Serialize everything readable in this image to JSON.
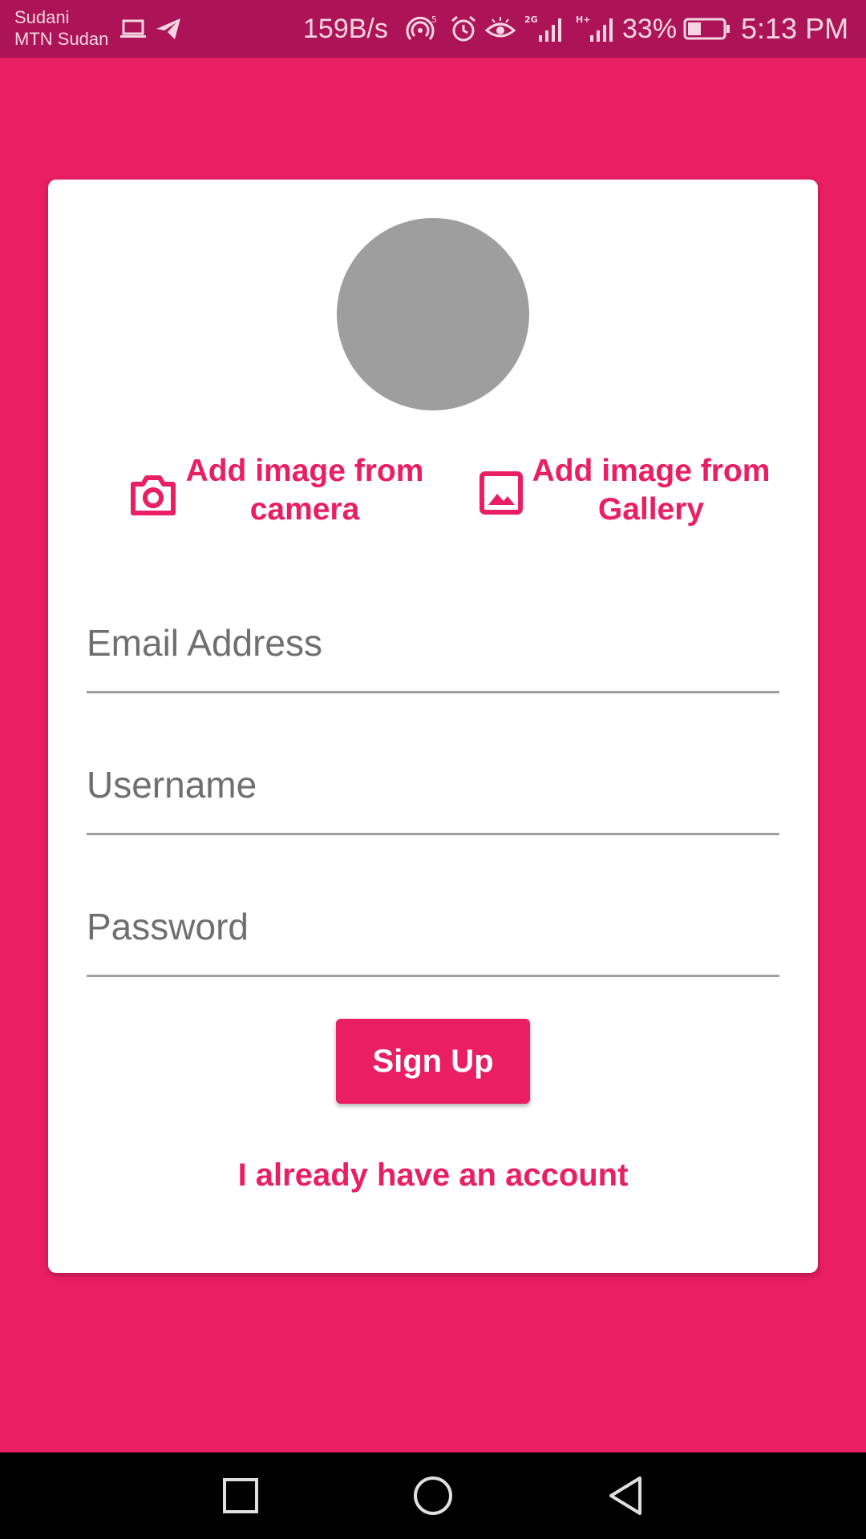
{
  "status_bar": {
    "carrier_line1": "Sudani",
    "carrier_line2": "MTN Sudan",
    "net_speed": "159B/s",
    "battery": "33%",
    "time": "5:13 PM",
    "icons": [
      "laptop-icon",
      "telegram-icon",
      "hotspot-icon",
      "alarm-icon",
      "eye-icon",
      "signal-2g-icon",
      "signal-h-icon",
      "battery-icon"
    ]
  },
  "form": {
    "camera_label": "Add image from camera",
    "gallery_label": "Add image from Gallery",
    "email_placeholder": "Email Address",
    "username_placeholder": "Username",
    "password_placeholder": "Password",
    "signup_label": "Sign Up",
    "login_link": "I already have an account"
  },
  "nav": {
    "icons": [
      "recents-square-icon",
      "home-circle-icon",
      "back-triangle-icon"
    ]
  },
  "colors": {
    "background": "#E91E63",
    "status_bar": "#AD1457",
    "accent": "#E91E63",
    "avatar": "#9E9E9E"
  }
}
